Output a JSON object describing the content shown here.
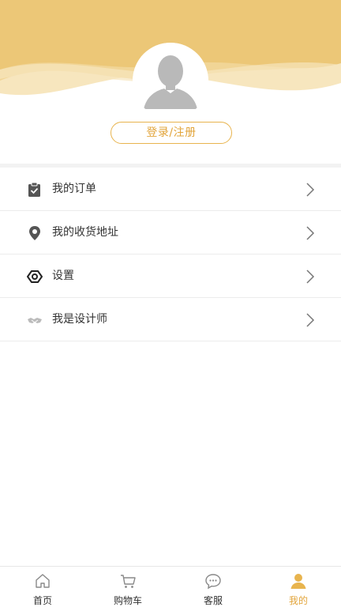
{
  "profile": {
    "login_label": "登录/注册"
  },
  "menu": {
    "items": [
      {
        "label": "我的订单",
        "icon": "clipboard-check-icon"
      },
      {
        "label": "我的收货地址",
        "icon": "location-pin-icon"
      },
      {
        "label": "设置",
        "icon": "gear-icon"
      },
      {
        "label": "我是设计师",
        "icon": "handshake-icon"
      }
    ]
  },
  "tabbar": {
    "tabs": [
      {
        "label": "首页",
        "icon": "home-icon",
        "active": false
      },
      {
        "label": "购物车",
        "icon": "cart-icon",
        "active": false
      },
      {
        "label": "客服",
        "icon": "chat-bubble-icon",
        "active": false
      },
      {
        "label": "我的",
        "icon": "person-icon",
        "active": true
      }
    ]
  },
  "colors": {
    "accent": "#e2a43a",
    "header_wave": "#ecc777"
  }
}
